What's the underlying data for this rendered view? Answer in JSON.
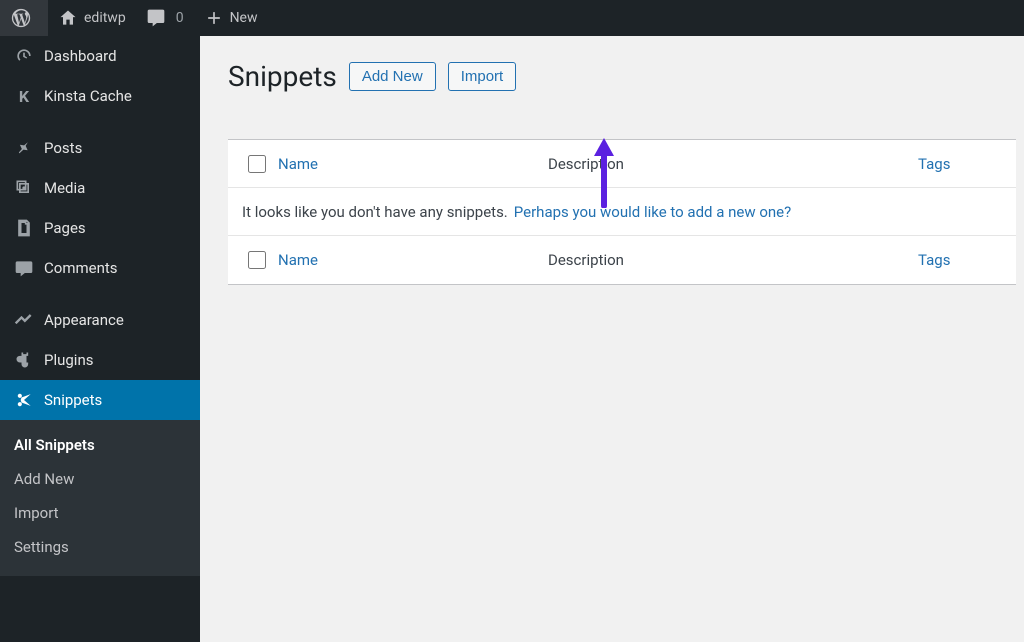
{
  "adminbar": {
    "site_name": "editwp",
    "comments_count": "0",
    "new_label": "New"
  },
  "sidebar": {
    "items": [
      {
        "icon": "dashboard",
        "label": "Dashboard"
      },
      {
        "icon": "kinsta",
        "label": "Kinsta Cache"
      },
      {
        "separator": true
      },
      {
        "icon": "pin",
        "label": "Posts"
      },
      {
        "icon": "media",
        "label": "Media"
      },
      {
        "icon": "pages",
        "label": "Pages"
      },
      {
        "icon": "comment",
        "label": "Comments"
      },
      {
        "separator": true
      },
      {
        "icon": "brush",
        "label": "Appearance"
      },
      {
        "icon": "plug",
        "label": "Plugins"
      },
      {
        "icon": "scissors",
        "label": "Snippets",
        "active": true,
        "submenu": [
          {
            "label": "All Snippets",
            "active": true
          },
          {
            "label": "Add New"
          },
          {
            "label": "Import"
          },
          {
            "label": "Settings"
          }
        ]
      }
    ]
  },
  "page": {
    "title": "Snippets",
    "add_new_label": "Add New",
    "import_label": "Import"
  },
  "table": {
    "columns": {
      "name": "Name",
      "description": "Description",
      "tags": "Tags"
    },
    "empty_message": "It looks like you don't have any snippets.",
    "empty_link": "Perhaps you would like to add a new one?"
  }
}
